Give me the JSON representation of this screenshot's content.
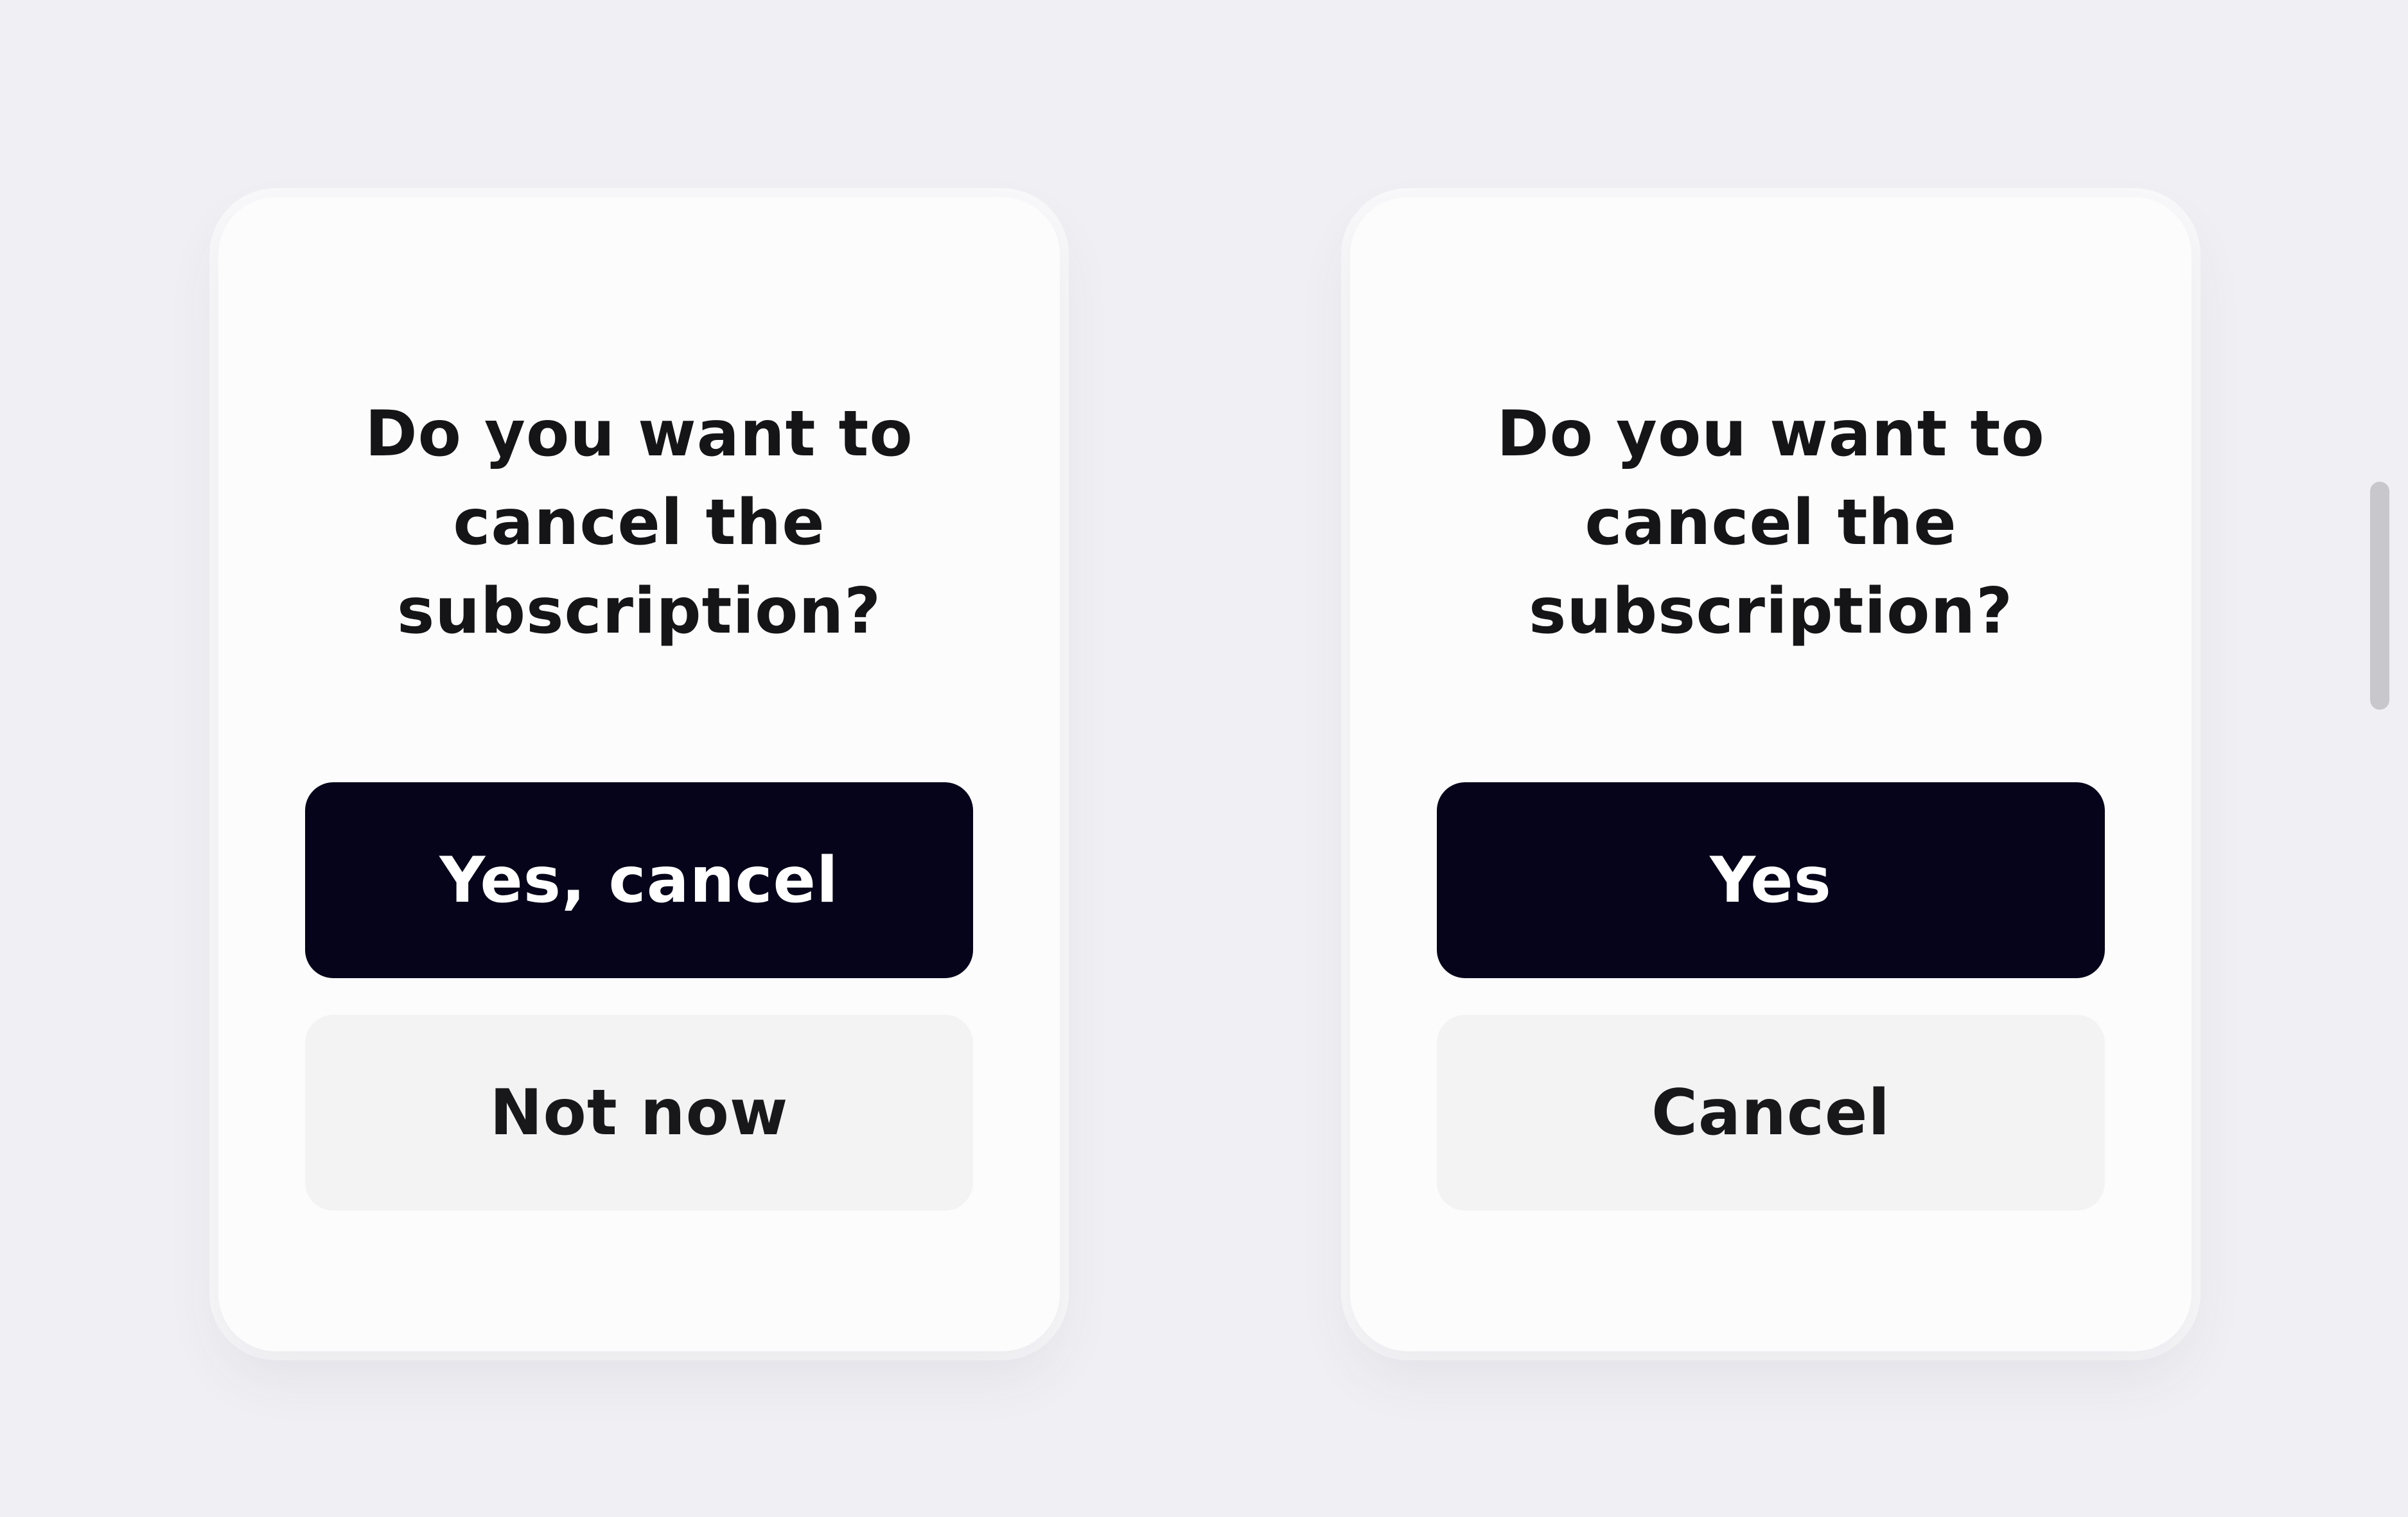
{
  "dialogs": [
    {
      "question": "Do you want to\ncancel the\nsubscription?",
      "primary_label": "Yes, cancel",
      "secondary_label": "Not now"
    },
    {
      "question": "Do you want to\ncancel the\nsubscription?",
      "primary_label": "Yes",
      "secondary_label": "Cancel"
    }
  ],
  "colors": {
    "background": "#f0f0f4",
    "card": "#fcfcfd",
    "primary_button": "#05041a",
    "secondary_button": "#f3f3f4",
    "text": "#151518"
  }
}
